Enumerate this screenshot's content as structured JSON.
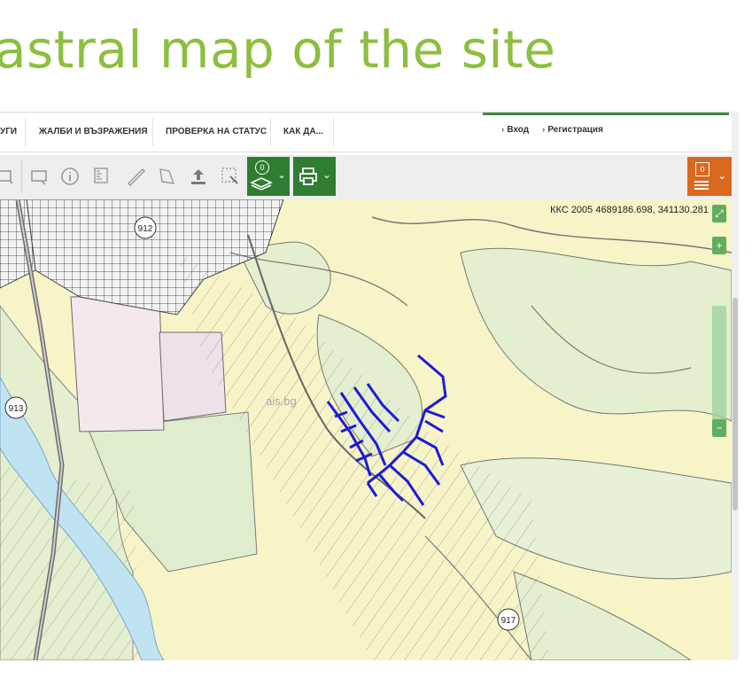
{
  "slide": {
    "title": "astral map of the site"
  },
  "nav": {
    "items": [
      "УГИ",
      "ЖАЛБИ И ВЪЗРАЖЕНИЯ",
      "ПРОВЕРКА НА СТАТУС",
      "КАК ДА..."
    ],
    "login": "Вход",
    "register": "Регистрация"
  },
  "toolbar": {
    "icons": [
      "rectangle-select-icon",
      "rectangle-select-2-icon",
      "info-icon",
      "measure-area-icon",
      "ruler-icon",
      "polygon-icon",
      "upload-icon",
      "select-area-icon"
    ],
    "layers_count": "0",
    "print_icon": "printer-icon",
    "cart_count": "0"
  },
  "map": {
    "coordinates": "ККС 2005 4689186.698, 341130.281",
    "watermark": "ais.bg",
    "labels": [
      "912",
      "913",
      "917"
    ],
    "zoom_in": "+",
    "zoom_out": "−",
    "colors": {
      "land": "#f7f4c8",
      "forest": "#e3efcf",
      "urban": "#f3e8ee",
      "selection": "#1c1cd6",
      "river": "#bfe3f0"
    }
  }
}
